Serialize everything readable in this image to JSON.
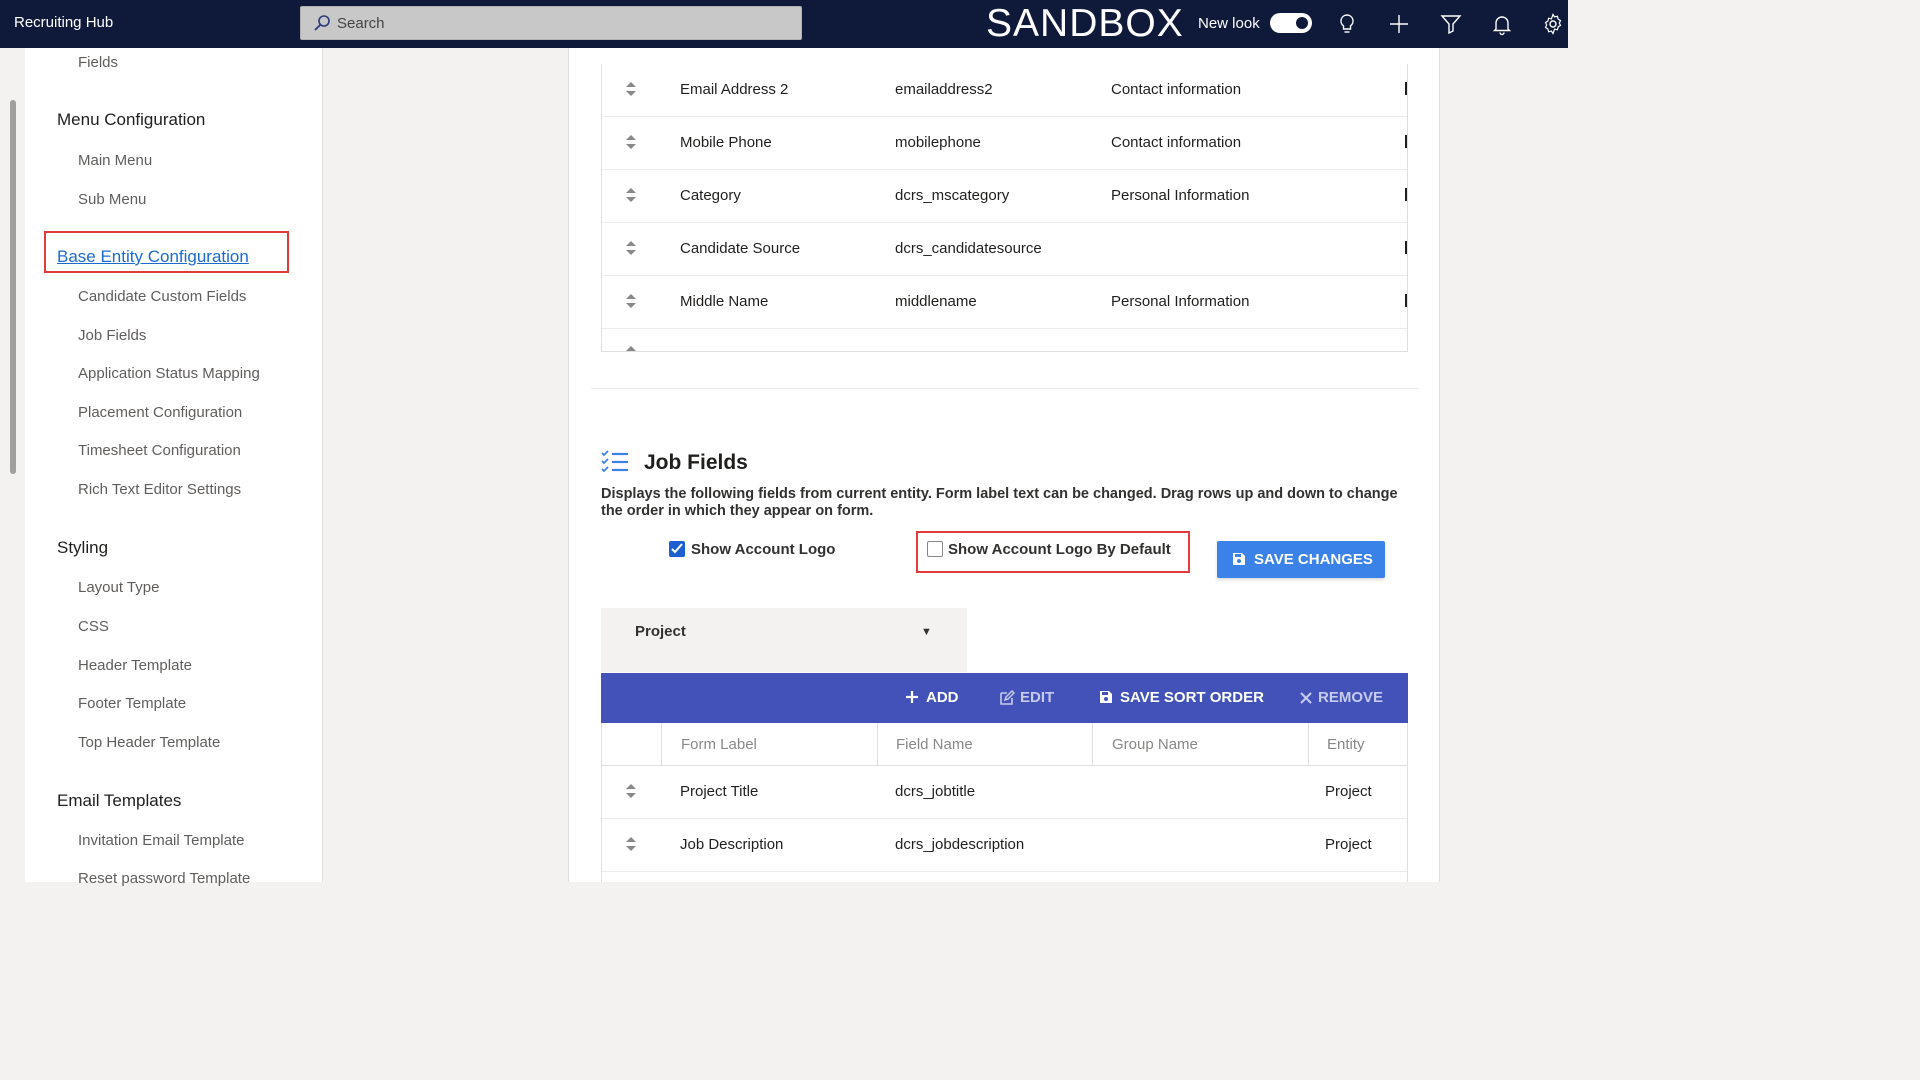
{
  "topbar": {
    "app_title": "Recruiting Hub",
    "search_placeholder": "Search",
    "environment": "SANDBOX",
    "new_look_label": "New look",
    "new_look_on": true,
    "icons": [
      "lightbulb-icon",
      "plus-icon",
      "filter-icon",
      "bell-icon",
      "gear-icon"
    ]
  },
  "sidebar": {
    "top_item": "Fields",
    "sections": [
      {
        "title": "Menu Configuration",
        "items": [
          "Main Menu",
          "Sub Menu"
        ]
      },
      {
        "title": "Base Entity Configuration",
        "active": true,
        "items": [
          "Candidate Custom Fields",
          "Job Fields",
          "Application Status Mapping",
          "Placement Configuration",
          "Timesheet Configuration",
          "Rich Text Editor Settings"
        ]
      },
      {
        "title": "Styling",
        "items": [
          "Layout Type",
          "CSS",
          "Header Template",
          "Footer Template",
          "Top Header Template"
        ]
      },
      {
        "title": "Email Templates",
        "items": [
          "Invitation Email Template",
          "Reset password Template"
        ]
      }
    ]
  },
  "candidate_fields_table": {
    "rows": [
      {
        "label": "Email Address 2",
        "field": "emailaddress2",
        "group": "Contact information"
      },
      {
        "label": "Mobile Phone",
        "field": "mobilephone",
        "group": "Contact information"
      },
      {
        "label": "Category",
        "field": "dcrs_mscategory",
        "group": "Personal Information"
      },
      {
        "label": "Candidate Source",
        "field": "dcrs_candidatesource",
        "group": ""
      },
      {
        "label": "Middle Name",
        "field": "middlename",
        "group": "Personal Information"
      }
    ]
  },
  "job_fields": {
    "title": "Job Fields",
    "description": "Displays the following fields from current entity. Form label text can be changed. Drag rows up and down to change the order in which they appear on form.",
    "show_account_logo": {
      "label": "Show Account Logo",
      "checked": true
    },
    "show_account_logo_default": {
      "label": "Show Account Logo By Default",
      "checked": false
    },
    "save_changes_label": "SAVE CHANGES",
    "entity_select": {
      "value": "Project"
    },
    "toolbar": {
      "add": "ADD",
      "edit": "EDIT",
      "save_sort": "SAVE SORT ORDER",
      "remove": "REMOVE"
    },
    "columns": [
      "Form Label",
      "Field Name",
      "Group Name",
      "Entity"
    ],
    "rows": [
      {
        "label": "Project Title",
        "field": "dcrs_jobtitle",
        "group": "",
        "entity": "Project"
      },
      {
        "label": "Job Description",
        "field": "dcrs_jobdescription",
        "group": "",
        "entity": "Project"
      }
    ]
  },
  "colors": {
    "topbar_bg": "#0f1a3a",
    "accent_blue": "#3b82e8",
    "toolbar_bg": "#4352b8",
    "highlight_red": "#e33b3b",
    "link_blue": "#1b6bd3"
  }
}
